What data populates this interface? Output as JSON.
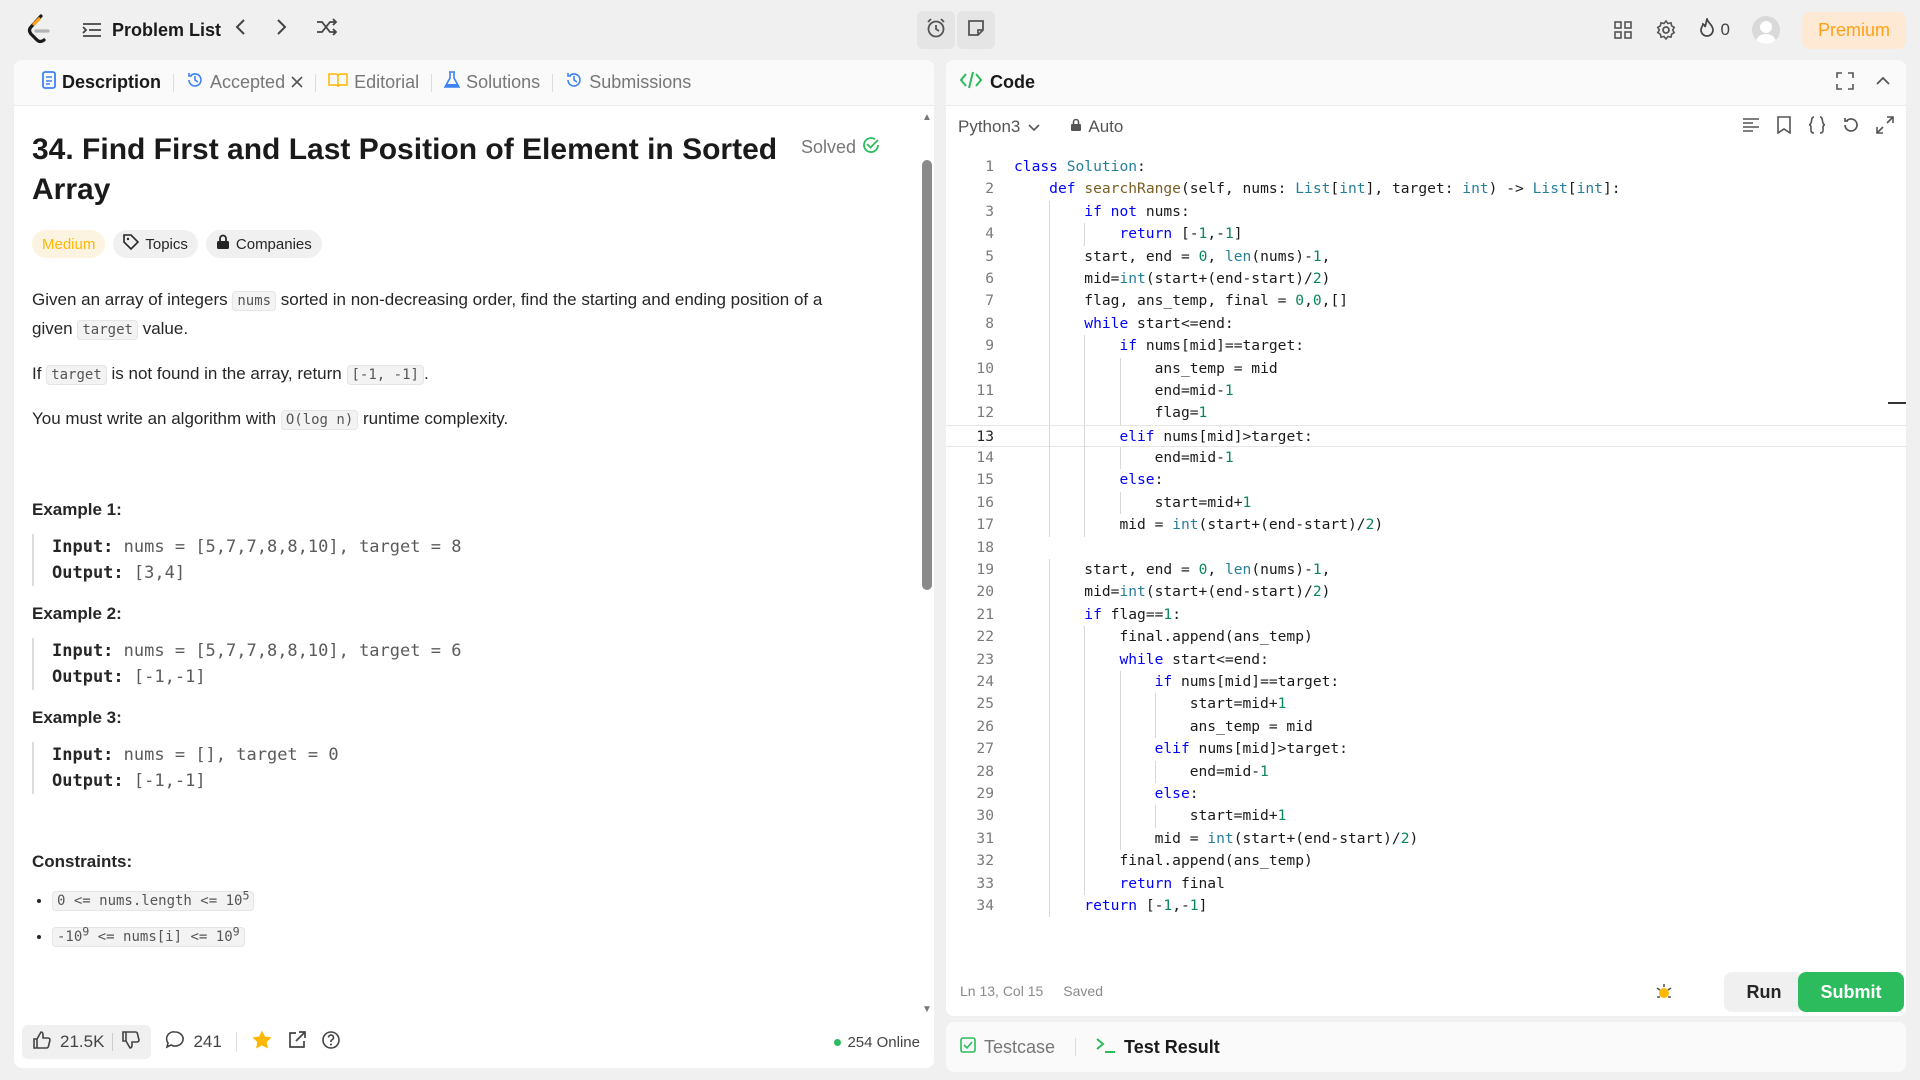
{
  "topbar": {
    "problem_list_label": "Problem List",
    "streak_count": "0",
    "premium_label": "Premium"
  },
  "tabs": {
    "description": "Description",
    "accepted": "Accepted",
    "editorial": "Editorial",
    "solutions": "Solutions",
    "submissions": "Submissions"
  },
  "problem": {
    "title_line1": "34. Find First and Last Position of Element in Sorted",
    "title_line2": "Array",
    "solved_label": "Solved",
    "difficulty": "Medium",
    "topics_label": "Topics",
    "companies_label": "Companies",
    "p1_a": "Given an array of integers",
    "p1_code1": "nums",
    "p1_b": "sorted in non-decreasing order, find the starting and ending position of a",
    "p1_c": "given",
    "p1_code2": "target",
    "p1_d": "value.",
    "p2_a": "If",
    "p2_code1": "target",
    "p2_b": "is not found in the array, return",
    "p2_code2": "[-1, -1]",
    "p2_c": ".",
    "p3_a": "You must write an algorithm with",
    "p3_code": "O(log n)",
    "p3_b": "runtime complexity.",
    "examples": [
      {
        "title": "Example 1:",
        "input_label": "Input:",
        "input": "nums = [5,7,7,8,8,10], target = 8",
        "output_label": "Output:",
        "output": "[3,4]"
      },
      {
        "title": "Example 2:",
        "input_label": "Input:",
        "input": "nums = [5,7,7,8,8,10], target = 6",
        "output_label": "Output:",
        "output": "[-1,-1]"
      },
      {
        "title": "Example 3:",
        "input_label": "Input:",
        "input": "nums = [], target = 0",
        "output_label": "Output:",
        "output": "[-1,-1]"
      }
    ],
    "constraints_title": "Constraints:",
    "constraints": [
      {
        "pre": "0 <= nums.length <= 10",
        "sup": "5",
        "post": ""
      },
      {
        "pre": "-10",
        "sup": "9",
        "post": " <= nums[i] <= 10",
        "sup2": "9"
      }
    ]
  },
  "bottom": {
    "likes": "21.5K",
    "comments": "241",
    "online": "254 Online"
  },
  "code": {
    "header": "Code",
    "language": "Python3",
    "mode": "Auto",
    "status": "Ln 13, Col 15",
    "saved": "Saved",
    "run_label": "Run",
    "submit_label": "Submit",
    "current_line": 13,
    "lines": [
      "class Solution:",
      "    def searchRange(self, nums: List[int], target: int) -> List[int]:",
      "        if not nums:",
      "            return [-1,-1]",
      "        start, end = 0, len(nums)-1,",
      "        mid=int(start+(end-start)/2)",
      "        flag, ans_temp, final = 0,0,[]",
      "        while start<=end:",
      "            if nums[mid]==target:",
      "                ans_temp = mid",
      "                end=mid-1",
      "                flag=1",
      "            elif nums[mid]>target:",
      "                end=mid-1",
      "            else:",
      "                start=mid+1",
      "            mid = int(start+(end-start)/2)",
      "",
      "        start, end = 0, len(nums)-1,",
      "        mid=int(start+(end-start)/2)",
      "        if flag==1:",
      "            final.append(ans_temp)",
      "            while start<=end:",
      "                if nums[mid]==target:",
      "                    start=mid+1",
      "                    ans_temp = mid",
      "                elif nums[mid]>target:",
      "                    end=mid-1",
      "                else:",
      "                    start=mid+1",
      "                mid = int(start+(end-start)/2)",
      "            final.append(ans_temp)",
      "            return final",
      "        return [-1,-1]"
    ]
  },
  "test": {
    "testcase_label": "Testcase",
    "result_label": "Test Result"
  },
  "colors": {
    "accent": "#ffa116",
    "green": "#2cbb5d",
    "medium": "#ffb800"
  }
}
